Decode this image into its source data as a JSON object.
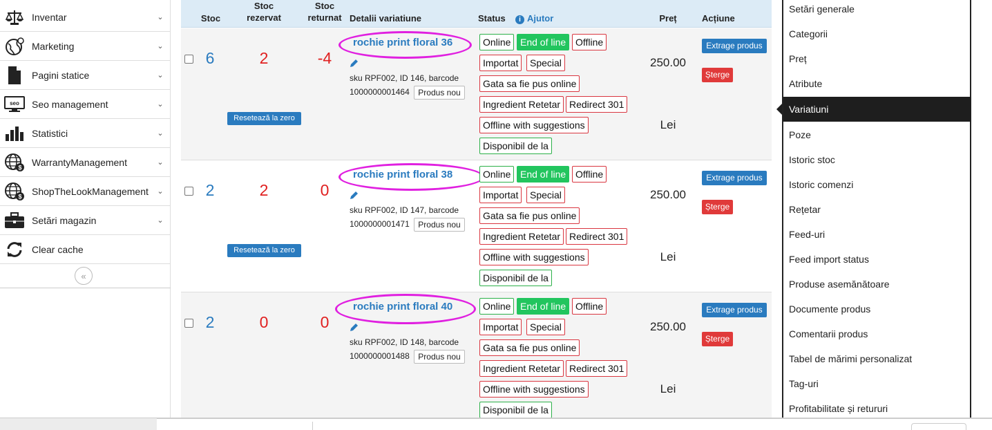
{
  "sidebar": {
    "items": [
      {
        "label": "Inventar",
        "icon": "scale-icon",
        "has_chevron": true
      },
      {
        "label": "Marketing",
        "icon": "globe-icon",
        "has_chevron": true
      },
      {
        "label": "Pagini statice",
        "icon": "file-icon",
        "has_chevron": true
      },
      {
        "label": "Seo management",
        "icon": "seo-monitor-icon",
        "has_chevron": true
      },
      {
        "label": "Statistici",
        "icon": "bar-chart-icon",
        "has_chevron": true
      },
      {
        "label": "WarrantyManagement",
        "icon": "globe-dollar-icon",
        "has_chevron": true
      },
      {
        "label": "ShopTheLookManagement",
        "icon": "globe-dollar-icon",
        "has_chevron": true
      },
      {
        "label": "Setări magazin",
        "icon": "briefcase-icon",
        "has_chevron": true
      },
      {
        "label": "Clear cache",
        "icon": "refresh-icon",
        "has_chevron": false
      }
    ],
    "collapse_glyph": "«"
  },
  "table": {
    "headers": {
      "stoc": "Stoc",
      "stoc_rezervat_1": "Stoc",
      "stoc_rezervat_2": "rezervat",
      "stoc_returnat_1": "Stoc",
      "stoc_returnat_2": "returnat",
      "detalii": "Detalii variatiune",
      "status": "Status",
      "ajutor": "Ajutor",
      "pret": "Preț",
      "actiune": "Acțiune"
    },
    "rows": [
      {
        "stoc": "6",
        "stoc_rezervat": "2",
        "stoc_returnat": "-4",
        "reset_label": "Resetează la zero",
        "name": "rochie print floral 36",
        "meta_line1": "sku RPF002,  ID 146,  barcode",
        "meta_line2": "1000000001464",
        "new_product_label": "Produs nou",
        "price": "250.00",
        "currency": "Lei",
        "extract_label": "Extrage produs",
        "delete_label": "Șterge"
      },
      {
        "stoc": "2",
        "stoc_rezervat": "2",
        "stoc_returnat": "0",
        "reset_label": "Resetează la zero",
        "name": "rochie print floral 38",
        "meta_line1": "sku RPF002,  ID 147,  barcode",
        "meta_line2": "1000000001471",
        "new_product_label": "Produs nou",
        "price": "250.00",
        "currency": "Lei",
        "extract_label": "Extrage produs",
        "delete_label": "Șterge"
      },
      {
        "stoc": "2",
        "stoc_rezervat": "0",
        "stoc_returnat": "0",
        "name": "rochie print floral 40",
        "meta_line1": "sku RPF002,  ID 148,  barcode",
        "meta_line2": "1000000001488",
        "new_product_label": "Produs nou",
        "price": "250.00",
        "currency": "Lei",
        "extract_label": "Extrage produs",
        "delete_label": "Șterge"
      }
    ],
    "status_tags": {
      "online": "Online",
      "end_of_line": "End of line",
      "offline": "Offline",
      "importat": "Importat",
      "special": "Special",
      "gata": "Gata sa fie pus online",
      "ingredient": "Ingredient Retetar",
      "redirect": "Redirect 301",
      "offline_suggestions": "Offline with suggestions",
      "disponibil": "Disponibil de la"
    }
  },
  "right_menu": {
    "items": [
      "Setări generale",
      "Categorii",
      "Preț",
      "Atribute",
      "Variatiuni",
      "Poze",
      "Istoric stoc",
      "Istoric comenzi",
      "Rețetar",
      "Feed-uri",
      "Feed import status",
      "Produse asemănătoare",
      "Documente produs",
      "Comentarii produs",
      "Tabel de mărimi personalizat",
      "Tag-uri",
      "Profitabilitate și retururi"
    ],
    "active": "Variatiuni"
  },
  "colors": {
    "link_blue": "#2a7bbf",
    "stock_red": "#e02020",
    "header_bg": "#dcebf6",
    "status_green": "#22c55e",
    "delete_red": "#e03a3a",
    "highlight_magenta": "#e020e0",
    "active_menu_bg": "#1e1e1e"
  }
}
